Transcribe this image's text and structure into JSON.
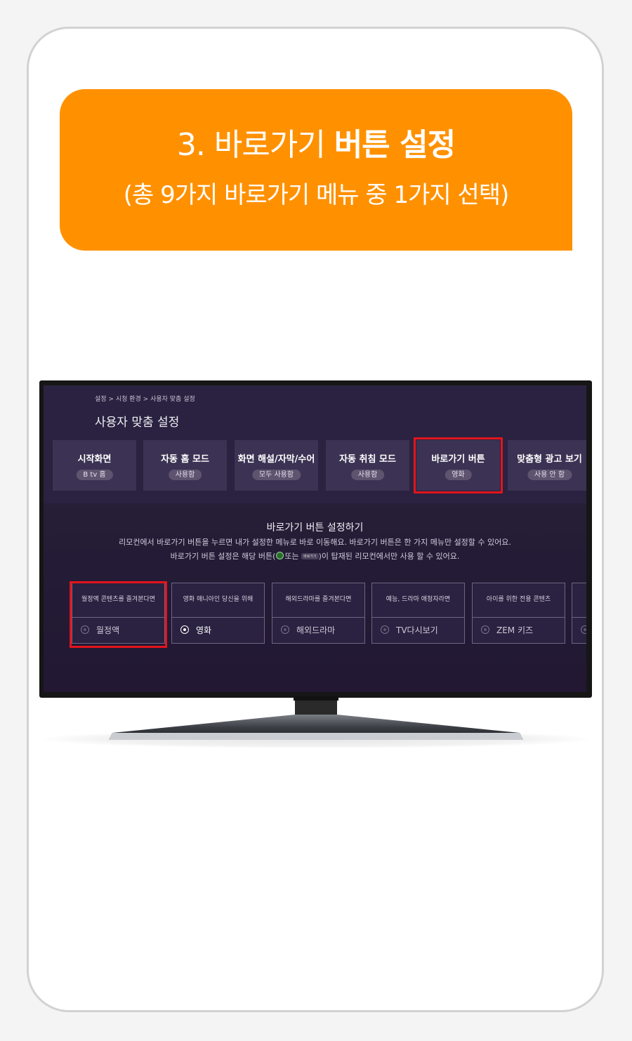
{
  "banner": {
    "title_prefix": "3. 바로가기",
    "title_bold": "버튼 설정",
    "subtitle": "(총 9가지 바로가기 메뉴 중 1가지 선택)"
  },
  "tv": {
    "breadcrumb": "설정 > 시청 환경 > 사용자 맞춤 설정",
    "page_title": "사용자 맞춤 설정",
    "tiles": [
      {
        "name": "시작화면",
        "value": "B tv 홈"
      },
      {
        "name": "자동 홈 모드",
        "value": "사용함"
      },
      {
        "name": "화면 해설/자막/수어",
        "value": "모두 사용함"
      },
      {
        "name": "자동 취침 모드",
        "value": "사용함"
      },
      {
        "name": "바로가기 버튼",
        "value": "영화"
      },
      {
        "name": "맞춤형 광고 보기",
        "value": "사용 안 함"
      }
    ],
    "section_title": "바로가기 버튼 설정하기",
    "description_line1": "리모컨에서 바로가기 버튼을 누르면 내가 설정한 메뉴로 바로 이동해요. 바로가기 버튼은 한 가지 메뉴만 설정할 수 있어요.",
    "description_line2_a": "바로가기 버튼 설정은 해당 버튼(",
    "description_line2_b": "또는",
    "description_line2_mini": "바로가기",
    "description_line2_c": ")이 탑재된 리모컨에서만 사용 할 수 있어요.",
    "options": [
      {
        "desc": "월정액 콘텐츠를 즐겨본다면",
        "label": "월정액",
        "selected": false
      },
      {
        "desc": "영화 매니아인 당신을 위해",
        "label": "영화",
        "selected": true
      },
      {
        "desc": "해외드라마를 즐겨본다면",
        "label": "해외드라마",
        "selected": false
      },
      {
        "desc": "예능, 드라마 애청자라면",
        "label": "TV다시보기",
        "selected": false
      },
      {
        "desc": "아이를 위한 전용 콘텐츠",
        "label": "ZEM 키즈",
        "selected": false
      }
    ]
  },
  "colors": {
    "banner": "#ff9100",
    "highlight": "#e3141b",
    "screen_bg": "#261f37",
    "tile_bg": "#3c3253"
  }
}
